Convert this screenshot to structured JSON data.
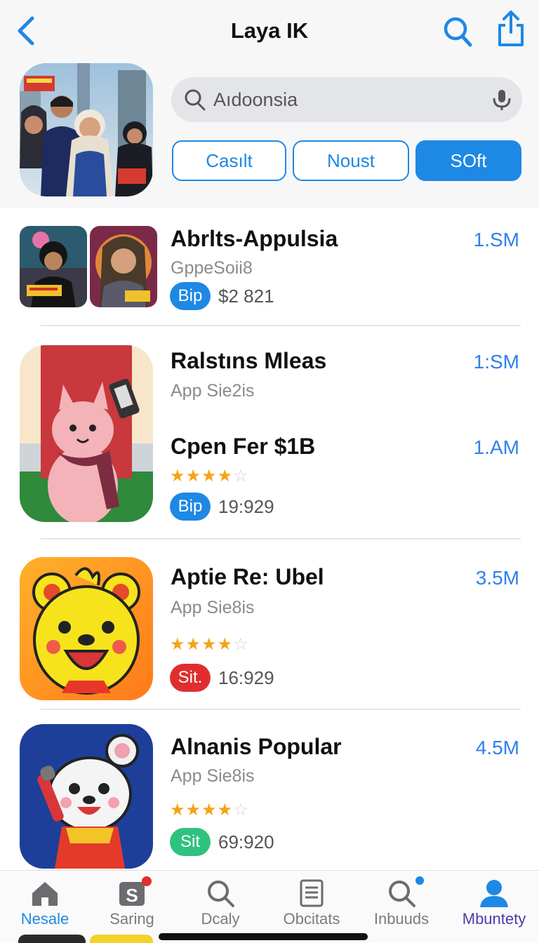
{
  "header": {
    "title": "Laya IK"
  },
  "search": {
    "value": "Aıdoonsia"
  },
  "chips": [
    {
      "label": "Casılt",
      "selected": false
    },
    {
      "label": "Noust",
      "selected": false
    },
    {
      "label": "SOft",
      "selected": true
    }
  ],
  "apps": [
    {
      "title": "Abrlts-Appulsia",
      "subtitle": "GppeSoii8",
      "size": "1.SM",
      "badge": "Bip",
      "meta": "$2 821",
      "badge_color": "#1e88e5"
    },
    {
      "title": "Ralstıns Mleas",
      "subtitle": "App Sie2is",
      "size": "1:SM",
      "extra_title": "Cpen Fer $1B",
      "extra_size": "1.AM",
      "rating": 3.5,
      "badge": "Bip",
      "meta": "19:929",
      "badge_color": "#1e88e5"
    },
    {
      "title": "Aptie Re: Ubel",
      "subtitle": "App Sie8is",
      "size": "3.5M",
      "rating": 3.5,
      "badge": "Sit.",
      "meta": "16:929",
      "badge_color": "#e02e2e"
    },
    {
      "title": "Alnanis Popular",
      "subtitle": "App Sie8is",
      "size": "4.5M",
      "rating": 3.5,
      "badge": "Sit",
      "meta": "69:920",
      "badge_color": "#2ec27e"
    }
  ],
  "tabs": [
    {
      "label": "Nesale",
      "icon": "home-icon",
      "active": true
    },
    {
      "label": "Saring",
      "icon": "s-square-icon",
      "active": false
    },
    {
      "label": "Dcaly",
      "icon": "search-icon",
      "active": false
    },
    {
      "label": "Obcitats",
      "icon": "document-icon",
      "active": false
    },
    {
      "label": "Inbuuds",
      "icon": "search-icon",
      "active": false
    },
    {
      "label": "Mbuntety",
      "icon": "person-icon",
      "active": true
    }
  ],
  "colors": {
    "accent": "#1e88e5",
    "star": "#f6a313"
  }
}
